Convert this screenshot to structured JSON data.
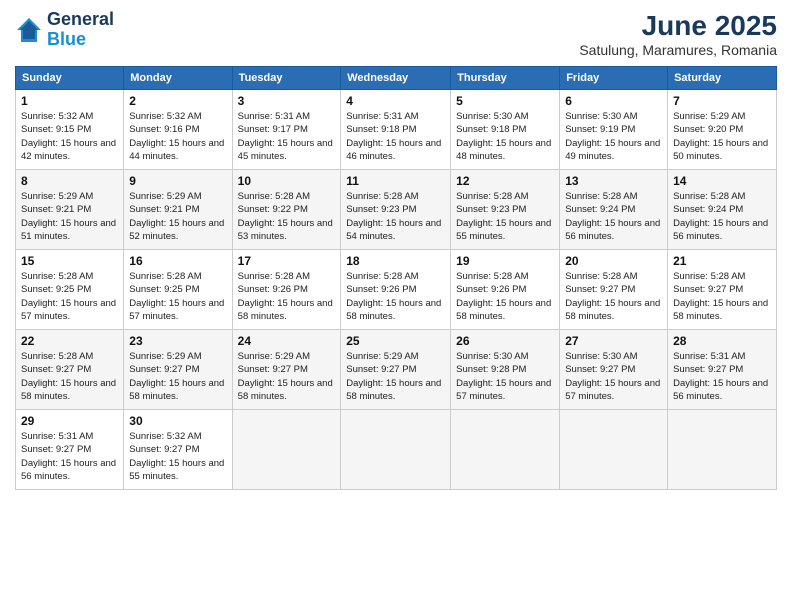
{
  "header": {
    "logo_line1": "General",
    "logo_line2": "Blue",
    "month": "June 2025",
    "location": "Satulung, Maramures, Romania"
  },
  "columns": [
    "Sunday",
    "Monday",
    "Tuesday",
    "Wednesday",
    "Thursday",
    "Friday",
    "Saturday"
  ],
  "rows": [
    [
      {
        "day": "1",
        "sunrise": "Sunrise: 5:32 AM",
        "sunset": "Sunset: 9:15 PM",
        "daylight": "Daylight: 15 hours and 42 minutes."
      },
      {
        "day": "2",
        "sunrise": "Sunrise: 5:32 AM",
        "sunset": "Sunset: 9:16 PM",
        "daylight": "Daylight: 15 hours and 44 minutes."
      },
      {
        "day": "3",
        "sunrise": "Sunrise: 5:31 AM",
        "sunset": "Sunset: 9:17 PM",
        "daylight": "Daylight: 15 hours and 45 minutes."
      },
      {
        "day": "4",
        "sunrise": "Sunrise: 5:31 AM",
        "sunset": "Sunset: 9:18 PM",
        "daylight": "Daylight: 15 hours and 46 minutes."
      },
      {
        "day": "5",
        "sunrise": "Sunrise: 5:30 AM",
        "sunset": "Sunset: 9:18 PM",
        "daylight": "Daylight: 15 hours and 48 minutes."
      },
      {
        "day": "6",
        "sunrise": "Sunrise: 5:30 AM",
        "sunset": "Sunset: 9:19 PM",
        "daylight": "Daylight: 15 hours and 49 minutes."
      },
      {
        "day": "7",
        "sunrise": "Sunrise: 5:29 AM",
        "sunset": "Sunset: 9:20 PM",
        "daylight": "Daylight: 15 hours and 50 minutes."
      }
    ],
    [
      {
        "day": "8",
        "sunrise": "Sunrise: 5:29 AM",
        "sunset": "Sunset: 9:21 PM",
        "daylight": "Daylight: 15 hours and 51 minutes."
      },
      {
        "day": "9",
        "sunrise": "Sunrise: 5:29 AM",
        "sunset": "Sunset: 9:21 PM",
        "daylight": "Daylight: 15 hours and 52 minutes."
      },
      {
        "day": "10",
        "sunrise": "Sunrise: 5:28 AM",
        "sunset": "Sunset: 9:22 PM",
        "daylight": "Daylight: 15 hours and 53 minutes."
      },
      {
        "day": "11",
        "sunrise": "Sunrise: 5:28 AM",
        "sunset": "Sunset: 9:23 PM",
        "daylight": "Daylight: 15 hours and 54 minutes."
      },
      {
        "day": "12",
        "sunrise": "Sunrise: 5:28 AM",
        "sunset": "Sunset: 9:23 PM",
        "daylight": "Daylight: 15 hours and 55 minutes."
      },
      {
        "day": "13",
        "sunrise": "Sunrise: 5:28 AM",
        "sunset": "Sunset: 9:24 PM",
        "daylight": "Daylight: 15 hours and 56 minutes."
      },
      {
        "day": "14",
        "sunrise": "Sunrise: 5:28 AM",
        "sunset": "Sunset: 9:24 PM",
        "daylight": "Daylight: 15 hours and 56 minutes."
      }
    ],
    [
      {
        "day": "15",
        "sunrise": "Sunrise: 5:28 AM",
        "sunset": "Sunset: 9:25 PM",
        "daylight": "Daylight: 15 hours and 57 minutes."
      },
      {
        "day": "16",
        "sunrise": "Sunrise: 5:28 AM",
        "sunset": "Sunset: 9:25 PM",
        "daylight": "Daylight: 15 hours and 57 minutes."
      },
      {
        "day": "17",
        "sunrise": "Sunrise: 5:28 AM",
        "sunset": "Sunset: 9:26 PM",
        "daylight": "Daylight: 15 hours and 58 minutes."
      },
      {
        "day": "18",
        "sunrise": "Sunrise: 5:28 AM",
        "sunset": "Sunset: 9:26 PM",
        "daylight": "Daylight: 15 hours and 58 minutes."
      },
      {
        "day": "19",
        "sunrise": "Sunrise: 5:28 AM",
        "sunset": "Sunset: 9:26 PM",
        "daylight": "Daylight: 15 hours and 58 minutes."
      },
      {
        "day": "20",
        "sunrise": "Sunrise: 5:28 AM",
        "sunset": "Sunset: 9:27 PM",
        "daylight": "Daylight: 15 hours and 58 minutes."
      },
      {
        "day": "21",
        "sunrise": "Sunrise: 5:28 AM",
        "sunset": "Sunset: 9:27 PM",
        "daylight": "Daylight: 15 hours and 58 minutes."
      }
    ],
    [
      {
        "day": "22",
        "sunrise": "Sunrise: 5:28 AM",
        "sunset": "Sunset: 9:27 PM",
        "daylight": "Daylight: 15 hours and 58 minutes."
      },
      {
        "day": "23",
        "sunrise": "Sunrise: 5:29 AM",
        "sunset": "Sunset: 9:27 PM",
        "daylight": "Daylight: 15 hours and 58 minutes."
      },
      {
        "day": "24",
        "sunrise": "Sunrise: 5:29 AM",
        "sunset": "Sunset: 9:27 PM",
        "daylight": "Daylight: 15 hours and 58 minutes."
      },
      {
        "day": "25",
        "sunrise": "Sunrise: 5:29 AM",
        "sunset": "Sunset: 9:27 PM",
        "daylight": "Daylight: 15 hours and 58 minutes."
      },
      {
        "day": "26",
        "sunrise": "Sunrise: 5:30 AM",
        "sunset": "Sunset: 9:28 PM",
        "daylight": "Daylight: 15 hours and 57 minutes."
      },
      {
        "day": "27",
        "sunrise": "Sunrise: 5:30 AM",
        "sunset": "Sunset: 9:27 PM",
        "daylight": "Daylight: 15 hours and 57 minutes."
      },
      {
        "day": "28",
        "sunrise": "Sunrise: 5:31 AM",
        "sunset": "Sunset: 9:27 PM",
        "daylight": "Daylight: 15 hours and 56 minutes."
      }
    ],
    [
      {
        "day": "29",
        "sunrise": "Sunrise: 5:31 AM",
        "sunset": "Sunset: 9:27 PM",
        "daylight": "Daylight: 15 hours and 56 minutes."
      },
      {
        "day": "30",
        "sunrise": "Sunrise: 5:32 AM",
        "sunset": "Sunset: 9:27 PM",
        "daylight": "Daylight: 15 hours and 55 minutes."
      },
      null,
      null,
      null,
      null,
      null
    ]
  ]
}
